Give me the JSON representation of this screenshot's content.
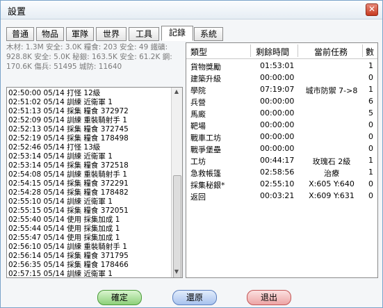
{
  "window": {
    "title": "設置",
    "close_icon": "✕"
  },
  "tabs": [
    "普通",
    "物品",
    "軍隊",
    "世界",
    "工具",
    "記錄",
    "系統"
  ],
  "stats": {
    "line1": "木材: 1.3M 安全: 3.0K 糧食: 203 安全: 49 鐵礦:",
    "line2": "928.8K 安全: 5.0K 秘銀: 163.5K 安全: 61.2K 鋼:",
    "line3": "170.6K 傷兵: 51495 城防: 11640"
  },
  "log": [
    "02:50:00 05/14 打怪 12級",
    "02:51:02 05/14 訓練 近衛軍 1",
    "02:51:13 05/14 採集 糧食 372972",
    "02:52:09 05/14 訓練 重裝騎射手 1",
    "02:52:13 05/14 採集 糧食 372745",
    "02:52:19 05/14 採集 糧食 178498",
    "02:52:46 05/14 打怪 13級",
    "02:53:14 05/14 訓練 近衛軍 1",
    "02:53:14 05/14 採集 糧食 372518",
    "02:54:08 05/14 訓練 重裝騎射手 1",
    "02:54:15 05/14 採集 糧食 372291",
    "02:54:28 05/14 採集 糧食 178482",
    "02:55:10 05/14 訓練 近衛軍 1",
    "02:55:15 05/14 採集 糧食 372051",
    "02:55:40 05/14 使用 採集加成 1",
    "02:55:44 05/14 使用 採集加成 1",
    "02:55:47 05/14 使用 採集加成 1",
    "02:56:10 05/14 訓練 重裝騎射手 1",
    "02:56:14 05/14 採集 糧食 371795",
    "02:56:35 05/14 採集 糧食 178466",
    "02:57:15 05/14 訓練 近衛軍 1"
  ],
  "queue": {
    "headers": [
      "類型",
      "剩餘時間",
      "當前任務",
      "數"
    ],
    "rows": [
      [
        "貨物獎勵",
        "01:53:01",
        "",
        "1"
      ],
      [
        "建築升級",
        "00:00:00",
        "",
        "0"
      ],
      [
        "學院",
        "07:19:07",
        "城市防禦 7->8",
        "1"
      ],
      [
        "兵營",
        "00:00:00",
        "",
        "6"
      ],
      [
        "馬廄",
        "00:00:00",
        "",
        "5"
      ],
      [
        "靶場",
        "00:00:00",
        "",
        "0"
      ],
      [
        "戰車工坊",
        "00:00:00",
        "",
        "0"
      ],
      [
        "戰爭堡壘",
        "00:00:00",
        "",
        "0"
      ],
      [
        "工坊",
        "00:44:17",
        "玫瑰石 2級",
        "1"
      ],
      [
        "急救帳篷",
        "02:58:56",
        "治療",
        "1"
      ],
      [
        "採集秘銀*",
        "02:55:10",
        "X:605 Y:640",
        "0"
      ],
      [
        "返回",
        "00:03:21",
        "X:609 Y:631",
        "0"
      ]
    ]
  },
  "buttons": {
    "ok": "確定",
    "revert": "還原",
    "exit": "退出"
  }
}
